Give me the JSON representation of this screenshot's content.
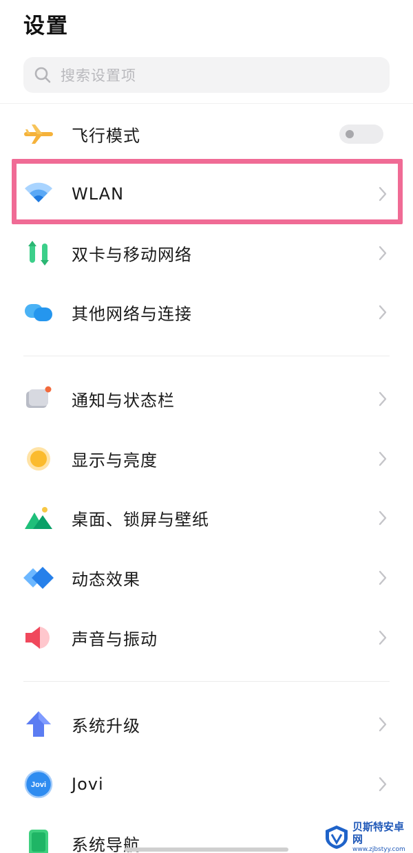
{
  "header": {
    "title": "设置"
  },
  "search": {
    "placeholder": "搜索设置项"
  },
  "rows": [
    {
      "label": "飞行模式",
      "icon": "airplane-icon",
      "type": "toggle",
      "on": false
    },
    {
      "label": "WLAN",
      "icon": "wifi-icon",
      "type": "link",
      "highlighted": true
    },
    {
      "label": "双卡与移动网络",
      "icon": "dual-sim-icon",
      "type": "link"
    },
    {
      "label": "其他网络与连接",
      "icon": "connections-icon",
      "type": "link"
    },
    {
      "label": "通知与状态栏",
      "icon": "notification-icon",
      "type": "link"
    },
    {
      "label": "显示与亮度",
      "icon": "brightness-icon",
      "type": "link"
    },
    {
      "label": "桌面、锁屏与壁纸",
      "icon": "wallpaper-icon",
      "type": "link"
    },
    {
      "label": "动态效果",
      "icon": "animation-icon",
      "type": "link"
    },
    {
      "label": "声音与振动",
      "icon": "speaker-icon",
      "type": "link"
    },
    {
      "label": "系统升级",
      "icon": "upgrade-arrow-icon",
      "type": "link"
    },
    {
      "label": "Jovi",
      "icon": "jovi-icon",
      "type": "link"
    },
    {
      "label": "系统导航",
      "icon": "navigation-icon",
      "type": "link"
    }
  ],
  "jovi_icon_text": "Jovi",
  "watermark": {
    "name": "贝斯特安卓网",
    "url": "www.zjbstyy.com"
  },
  "colors": {
    "highlight_border": "#f06b95",
    "accent_blue": "#2f8cf0"
  }
}
